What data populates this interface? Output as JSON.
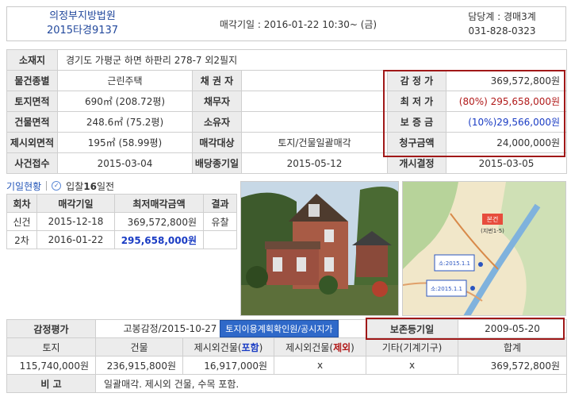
{
  "header": {
    "court": "의정부지방법원",
    "case_no": "2015타경9137",
    "sale_date": "매각기일 : 2016-01-22   10:30~ (금)",
    "officer": "담당계 : 경매3계",
    "phone": "031-828-0323"
  },
  "main": {
    "address_label": "소재지",
    "address": "경기도 가평군 하면 하판리 278-7 외2필지",
    "rows": [
      {
        "l1": "물건종별",
        "v1": "근린주택",
        "l2": "채 권 자",
        "v2": "",
        "l3": "감 정 가",
        "v3": "369,572,800원"
      },
      {
        "l1": "토지면적",
        "v1": "690㎡ (208.72평)",
        "l2": "채무자",
        "v2": "",
        "l3": "최 저 가",
        "v3_pct": "(80%)",
        "v3": "295,658,000원"
      },
      {
        "l1": "건물면적",
        "v1": "248.6㎡ (75.2평)",
        "l2": "소유자",
        "v2": "",
        "l3": "보 증 금",
        "v3": "(10%)29,566,000원"
      },
      {
        "l1": "제시외면적",
        "v1": "195㎡ (58.99평)",
        "l2": "매각대상",
        "v2": "토지/건물일괄매각",
        "l3": "청구금액",
        "v3": "24,000,000원"
      }
    ],
    "last_row": {
      "l1": "사건접수",
      "v1": "2015-03-04",
      "l2": "배당종기일",
      "v2": "2015-05-12",
      "l3": "개시결정",
      "v3": "2015-03-05"
    }
  },
  "history": {
    "tab": "기일현황",
    "sale_count_prefix": "입찰",
    "sale_count_num": "16",
    "sale_count_suffix": "일전",
    "columns": [
      "회차",
      "매각기일",
      "최저매각금액",
      "결과"
    ],
    "rows": [
      {
        "round": "신건",
        "date": "2015-12-18",
        "amount": "369,572,800원",
        "result": "유찰"
      },
      {
        "round": "2차",
        "date": "2016-01-22",
        "amount": "295,658,000원",
        "result": ""
      }
    ]
  },
  "map": {
    "target_label": "본건",
    "target_sub": "(지번1-5)",
    "box1": "소:2015.1.1",
    "box2": "소:2015.1.1"
  },
  "appraisal": {
    "label": "감정평가",
    "value": "고봉감정/2015-10-27",
    "button": "토지이용계획확인원/공시지가",
    "preserve_label": "보존등기일",
    "preserve_date": "2009-05-20",
    "columns": [
      "토지",
      "건물",
      "제시외건물(포함)",
      "제시외건물(제외)",
      "기타(기계기구)",
      "합계"
    ],
    "col3_prefix": "제시외건물(",
    "col3_mid": "포함",
    "col4_mid": "제외",
    "col_suffix": ")",
    "values": [
      "115,740,000원",
      "236,915,800원",
      "16,917,000원",
      "x",
      "x",
      "369,572,800원"
    ],
    "note_label": "비 고",
    "note": "일괄매각. 제시외 건물, 수목 포함."
  }
}
